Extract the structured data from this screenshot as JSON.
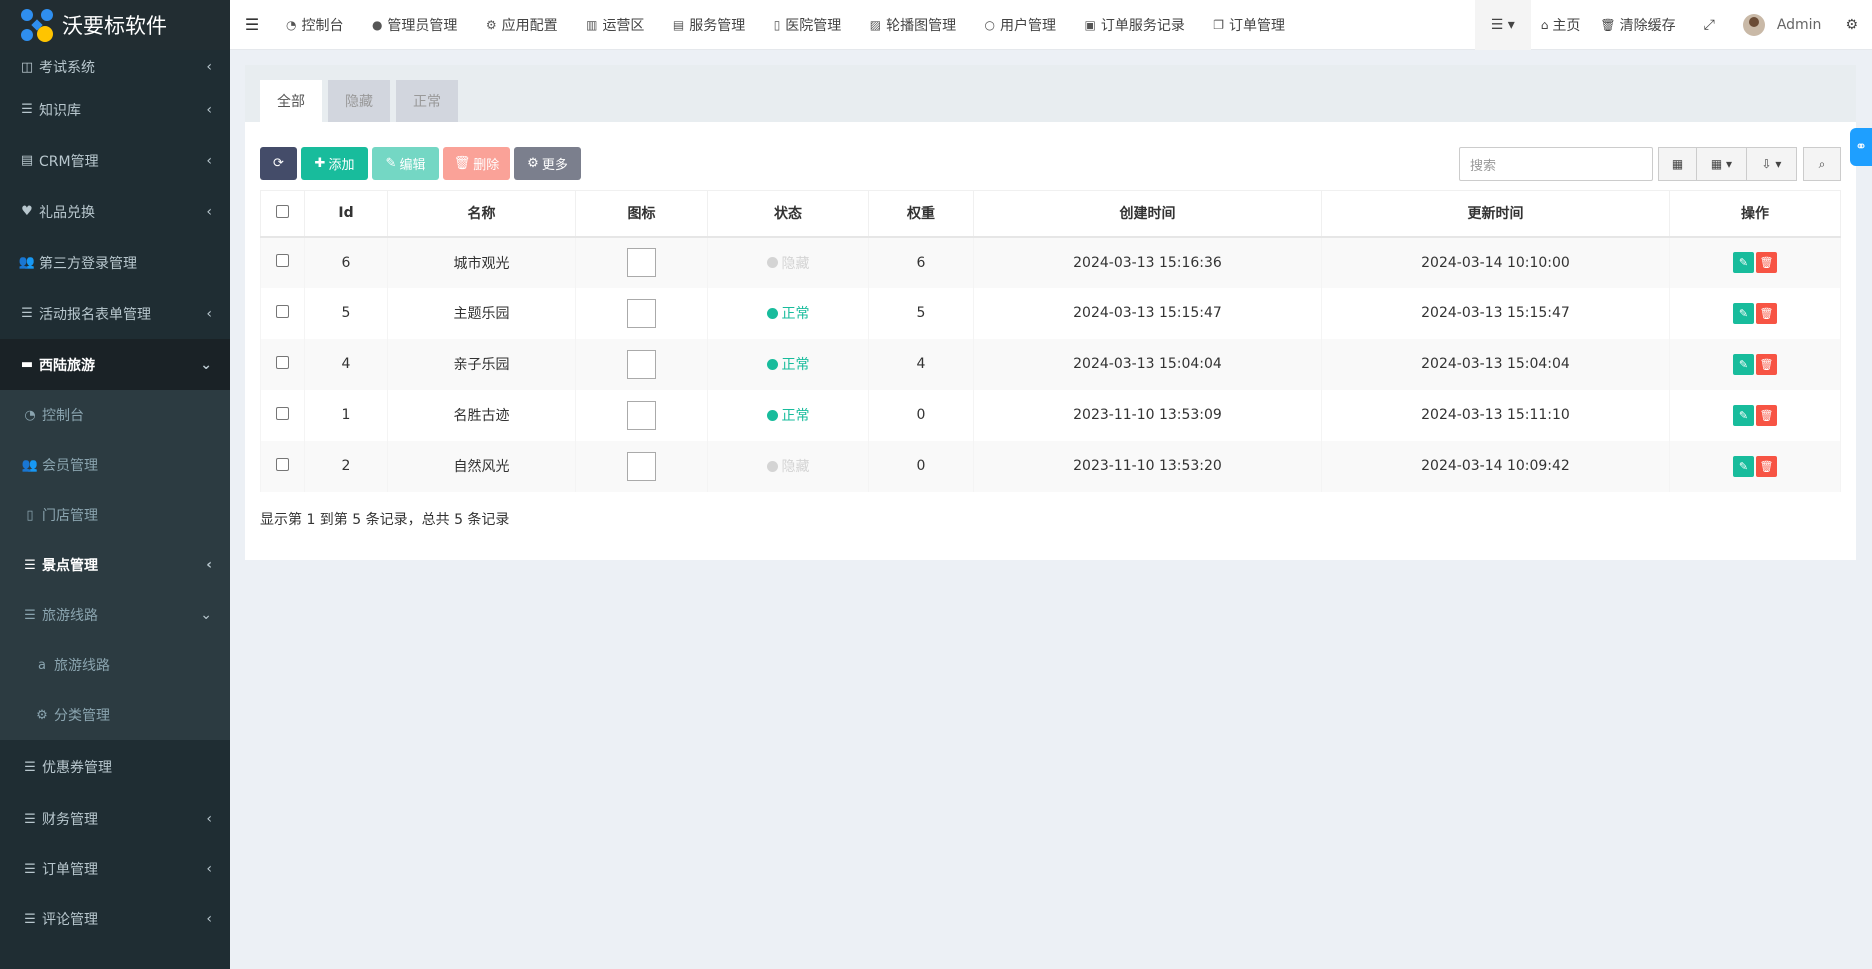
{
  "brand": {
    "name": "沃要标软件"
  },
  "sidebar": {
    "items": [
      {
        "label": "考试系统",
        "icon": "columns-icon"
      },
      {
        "label": "知识库",
        "icon": "list-icon"
      },
      {
        "label": "CRM管理",
        "icon": "idcard-icon"
      },
      {
        "label": "礼品兑换",
        "icon": "heart-icon"
      },
      {
        "label": "第三方登录管理",
        "icon": "users-icon"
      },
      {
        "label": "活动报名表单管理",
        "icon": "list-icon"
      },
      {
        "label": "西陆旅游",
        "icon": "folder-icon"
      }
    ],
    "sub": [
      {
        "label": "控制台",
        "icon": "dashboard-icon"
      },
      {
        "label": "会员管理",
        "icon": "users-icon"
      },
      {
        "label": "门店管理",
        "icon": "building-icon"
      },
      {
        "label": "景点管理",
        "icon": "list-icon"
      },
      {
        "label": "旅游线路",
        "icon": "list-icon"
      },
      {
        "label": "旅游线路",
        "icon": "amazon-icon"
      },
      {
        "label": "分类管理",
        "icon": "cogs-icon"
      },
      {
        "label": "优惠券管理",
        "icon": "list-icon"
      },
      {
        "label": "财务管理",
        "icon": "list-icon"
      },
      {
        "label": "订单管理",
        "icon": "list-icon"
      },
      {
        "label": "评论管理",
        "icon": "list-icon"
      }
    ]
  },
  "topnav": {
    "items": [
      {
        "label": "控制台",
        "icon": "dashboard-icon"
      },
      {
        "label": "管理员管理",
        "icon": "user-icon"
      },
      {
        "label": "应用配置",
        "icon": "gear-icon"
      },
      {
        "label": "运营区",
        "icon": "map-icon"
      },
      {
        "label": "服务管理",
        "icon": "list-icon"
      },
      {
        "label": "医院管理",
        "icon": "clipboard-icon"
      },
      {
        "label": "轮播图管理",
        "icon": "image-icon"
      },
      {
        "label": "用户管理",
        "icon": "user-icon"
      },
      {
        "label": "订单服务记录",
        "icon": "save-icon"
      },
      {
        "label": "订单管理",
        "icon": "copy-icon"
      }
    ],
    "home": "主页",
    "clear_cache": "清除缓存",
    "user": "Admin"
  },
  "tabs": [
    "全部",
    "隐藏",
    "正常"
  ],
  "toolbar": {
    "add": "添加",
    "edit": "编辑",
    "delete": "删除",
    "more": "更多",
    "search_placeholder": "搜索"
  },
  "table": {
    "headers": [
      "Id",
      "名称",
      "图标",
      "状态",
      "权重",
      "创建时间",
      "更新时间",
      "操作"
    ],
    "rows": [
      {
        "id": "6",
        "name": "城市观光",
        "status": "隐藏",
        "status_on": false,
        "weight": "6",
        "created": "2024-03-13 15:16:36",
        "updated": "2024-03-14 10:10:00"
      },
      {
        "id": "5",
        "name": "主题乐园",
        "status": "正常",
        "status_on": true,
        "weight": "5",
        "created": "2024-03-13 15:15:47",
        "updated": "2024-03-13 15:15:47"
      },
      {
        "id": "4",
        "name": "亲子乐园",
        "status": "正常",
        "status_on": true,
        "weight": "4",
        "created": "2024-03-13 15:04:04",
        "updated": "2024-03-13 15:04:04"
      },
      {
        "id": "1",
        "name": "名胜古迹",
        "status": "正常",
        "status_on": true,
        "weight": "0",
        "created": "2023-11-10 13:53:09",
        "updated": "2024-03-13 15:11:10"
      },
      {
        "id": "2",
        "name": "自然风光",
        "status": "隐藏",
        "status_on": false,
        "weight": "0",
        "created": "2023-11-10 13:53:20",
        "updated": "2024-03-14 10:09:42"
      }
    ]
  },
  "pager": {
    "summary": "显示第 1 到第 5 条记录，总共 5 条记录"
  },
  "colors": {
    "sidebar": "#1f2d33",
    "success": "#18bc9c",
    "danger": "#f75444",
    "primary": "#444c69"
  }
}
